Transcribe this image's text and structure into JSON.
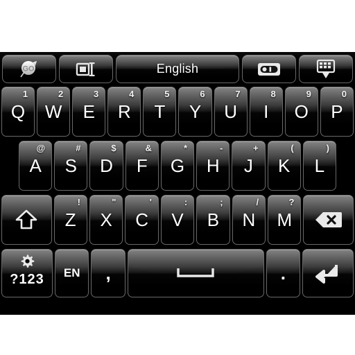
{
  "app": {
    "name": "GO Keyboard",
    "background_color": "#ffffff",
    "keyboard_background": "#000000",
    "key_text_color": "#ffffff"
  },
  "function_bar": {
    "keys": [
      {
        "name": "go-logo-key",
        "icon": "go-logo-icon",
        "label": ""
      },
      {
        "name": "layout-switch-key",
        "icon": "layout-resize-icon",
        "label": ""
      },
      {
        "name": "language-key",
        "icon": "",
        "label": "English"
      },
      {
        "name": "voice-input-key",
        "icon": "voice-capsule-icon",
        "label": ""
      },
      {
        "name": "hide-keyboard-key",
        "icon": "keyboard-hide-icon",
        "label": ""
      }
    ]
  },
  "rows": {
    "row1": [
      {
        "main": "Q",
        "alt": "1"
      },
      {
        "main": "W",
        "alt": "2"
      },
      {
        "main": "E",
        "alt": "3"
      },
      {
        "main": "R",
        "alt": "4"
      },
      {
        "main": "T",
        "alt": "5"
      },
      {
        "main": "Y",
        "alt": "6"
      },
      {
        "main": "U",
        "alt": "7"
      },
      {
        "main": "I",
        "alt": "8"
      },
      {
        "main": "O",
        "alt": "9"
      },
      {
        "main": "P",
        "alt": "0"
      }
    ],
    "row2": [
      {
        "main": "A",
        "alt": "@"
      },
      {
        "main": "S",
        "alt": "#"
      },
      {
        "main": "D",
        "alt": "$"
      },
      {
        "main": "F",
        "alt": "&"
      },
      {
        "main": "G",
        "alt": "*"
      },
      {
        "main": "H",
        "alt": "-"
      },
      {
        "main": "J",
        "alt": "+"
      },
      {
        "main": "K",
        "alt": "("
      },
      {
        "main": "L",
        "alt": ")"
      }
    ],
    "row3": {
      "shift": {
        "name": "shift-key",
        "icon": "shift-arrow-icon",
        "label": ""
      },
      "letters": [
        {
          "main": "Z",
          "alt": "!"
        },
        {
          "main": "X",
          "alt": "\""
        },
        {
          "main": "C",
          "alt": "'"
        },
        {
          "main": "V",
          "alt": ":"
        },
        {
          "main": "B",
          "alt": ";"
        },
        {
          "main": "N",
          "alt": "/"
        },
        {
          "main": "M",
          "alt": "?"
        }
      ],
      "backspace": {
        "name": "backspace-key",
        "icon": "backspace-icon",
        "label": ""
      }
    },
    "row4": [
      {
        "name": "symbols-key",
        "label": "?123",
        "icon": "gear-icon"
      },
      {
        "name": "language-toggle-key",
        "label": "EN",
        "icon": ""
      },
      {
        "name": "comma-key",
        "label": ",",
        "icon": ""
      },
      {
        "name": "space-key",
        "label": "",
        "icon": "space-bar-icon"
      },
      {
        "name": "period-key",
        "label": ".",
        "icon": ""
      },
      {
        "name": "enter-key",
        "label": "",
        "icon": "enter-arrow-icon"
      }
    ]
  }
}
